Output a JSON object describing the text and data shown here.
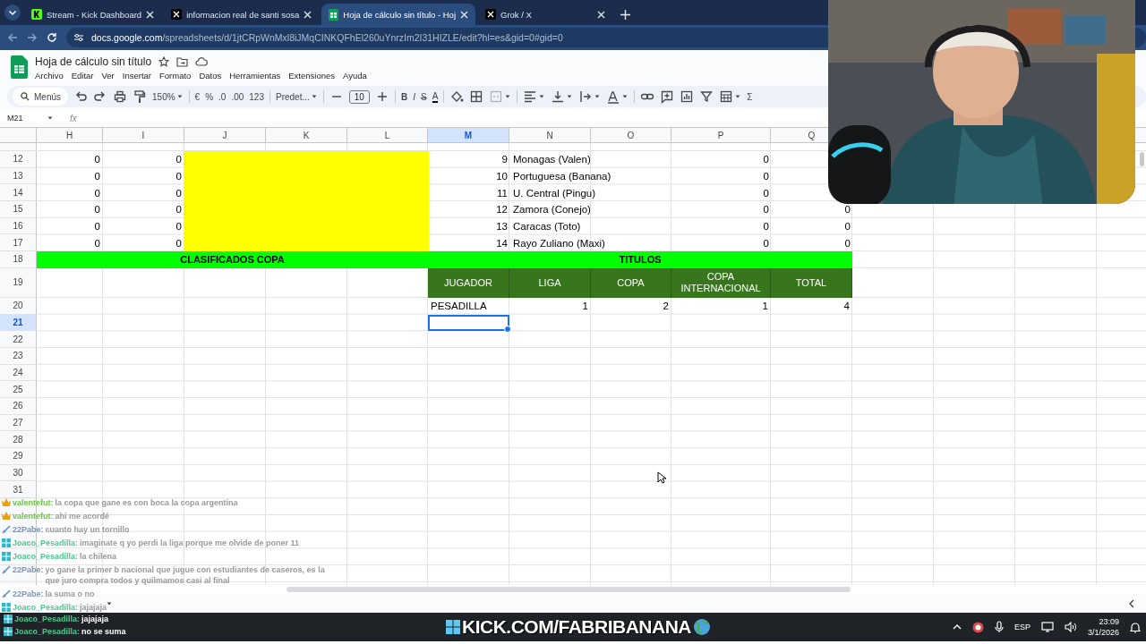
{
  "browser": {
    "tabs": [
      {
        "title": "Stream - Kick Dashboard",
        "kind": "dashboard",
        "selected": false
      },
      {
        "title": "informacion real de santi sosa",
        "kind": "social",
        "selected": false
      },
      {
        "title": "Hoja de cálculo sin título - Hoj",
        "kind": "spreadsheet",
        "selected": true
      },
      {
        "title": "Grok / X",
        "kind": "social",
        "selected": false
      }
    ],
    "url": "**docs.google.com**/spreadsheets/d/1jtCRpWnMxl8iJMqCINKQFhEl260uYnrzIm2I31HIZLE/edit?hl=es&gid=0#gid=0"
  },
  "sheet_app": {
    "title": "Hoja de cálculo sin título",
    "menu": [
      "Archivo",
      "Editar",
      "Ver",
      "Insertar",
      "Formato",
      "Datos",
      "Herramientas",
      "Extensiones",
      "Ayuda"
    ],
    "toolbar": {
      "search": "Menús",
      "zoom": "150%",
      "currency": "€",
      "percent": "%",
      "decrease_decimals": ".0",
      "increase_decimals": ".00",
      "number_format": "123",
      "font": "Predet...",
      "font_size": "10",
      "bold": "B",
      "italic": "I",
      "strikethrough": "S",
      "text_color": "A",
      "sum": "Σ"
    },
    "name_box": "M21",
    "formula_label": "fx"
  },
  "sheet": {
    "columns": [
      {
        "letter": "H",
        "selected": false
      },
      {
        "letter": "I",
        "selected": false
      },
      {
        "letter": "J",
        "selected": false
      },
      {
        "letter": "K",
        "selected": false
      },
      {
        "letter": "L",
        "selected": false
      },
      {
        "letter": "M",
        "selected": true
      },
      {
        "letter": "N",
        "selected": false
      },
      {
        "letter": "O",
        "selected": false
      },
      {
        "letter": "P",
        "selected": false
      },
      {
        "letter": "Q",
        "selected": false
      }
    ],
    "rows": [
      {
        "number": "12",
        "selected": false,
        "kind": "data",
        "highlighted": true,
        "cells": {
          "H": "0",
          "I": "0",
          "M": "9",
          "N": "Monagas (Valen)",
          "P": "0"
        }
      },
      {
        "number": "13",
        "selected": false,
        "kind": "data",
        "highlighted": true,
        "cells": {
          "H": "0",
          "I": "0",
          "M": "10",
          "N": "Portuguesa (Banana)",
          "P": "0"
        }
      },
      {
        "number": "14",
        "selected": false,
        "kind": "data",
        "highlighted": true,
        "cells": {
          "H": "0",
          "I": "0",
          "M": "11",
          "N": "U. Central (Pingu)",
          "P": "0"
        }
      },
      {
        "number": "15",
        "selected": false,
        "kind": "data",
        "highlighted": true,
        "cells": {
          "H": "0",
          "I": "0",
          "M": "12",
          "N": "Zamora (Conejo)",
          "P": "0",
          "Q": "0"
        }
      },
      {
        "number": "16",
        "selected": false,
        "kind": "data",
        "highlighted": true,
        "cells": {
          "H": "0",
          "I": "0",
          "M": "13",
          "N": "Caracas (Toto)",
          "P": "0",
          "Q": "0"
        }
      },
      {
        "number": "17",
        "selected": false,
        "kind": "data",
        "highlighted": true,
        "cells": {
          "H": "0",
          "I": "0",
          "M": "14",
          "N": "Rayo Zuliano (Maxi)",
          "P": "0",
          "Q": "0"
        }
      },
      {
        "number": "18",
        "selected": false,
        "kind": "banner",
        "left": {
          "text": "CLASIFICADOS COPA",
          "color": "#00ff00"
        },
        "right": {
          "text": "TITULOS",
          "color": "#00ff00"
        }
      },
      {
        "number": "19",
        "selected": false,
        "kind": "header",
        "color": "#38761d",
        "cells": {
          "M": "JUGADOR",
          "N": "LIGA",
          "O": "COPA",
          "P": "COPA INTERNACIONAL",
          "Q": "TOTAL"
        }
      },
      {
        "number": "20",
        "selected": false,
        "kind": "data",
        "cells": {
          "M": "PESADILLA",
          "N": "1",
          "O": "2",
          "P": "1",
          "Q": "4"
        }
      },
      {
        "number": "21",
        "selected": true,
        "kind": "data"
      },
      {
        "number": "22",
        "selected": false,
        "kind": "data"
      },
      {
        "number": "23",
        "selected": false,
        "kind": "data"
      },
      {
        "number": "24",
        "selected": false,
        "kind": "data"
      },
      {
        "number": "25",
        "selected": false,
        "kind": "data"
      },
      {
        "number": "26",
        "selected": false,
        "kind": "data"
      },
      {
        "number": "27",
        "selected": false,
        "kind": "data"
      },
      {
        "number": "28",
        "selected": false,
        "kind": "data"
      },
      {
        "number": "29",
        "selected": false,
        "kind": "data"
      },
      {
        "number": "30",
        "selected": false,
        "kind": "data"
      },
      {
        "number": "31",
        "selected": false,
        "kind": "data"
      }
    ]
  },
  "chat": [
    {
      "user": "valentefut:",
      "kind": "crown",
      "color": "#6cc644",
      "text": "la copa que gane es con boca la copa argentina"
    },
    {
      "user": "valentefut:",
      "kind": "crown",
      "color": "#6cc644",
      "text": "ahi me acordé"
    },
    {
      "user": "22Pabe:",
      "kind": "sword",
      "color": "#7f93b8",
      "text": "cuanto hay un tornillo"
    },
    {
      "user": "Joaco_Pesadilla:",
      "kind": "grid",
      "color": "#4fc98f",
      "text": "imaginate q yo perdi la liga porque me olvide de poner 11"
    },
    {
      "user": "Joaco_Pesadilla:",
      "kind": "grid",
      "color": "#4fc98f",
      "text": "la chilena"
    },
    {
      "user": "22Pabe:",
      "kind": "sword",
      "color": "#7f93b8",
      "text": "yo gane la primer b nacional que jugue con estudiantes de caseros, es la que juro compra todos y quilmamos casi al final"
    },
    {
      "user": "22Pabe:",
      "kind": "sword",
      "color": "#7f93b8",
      "text": "la suma o no"
    },
    {
      "user": "Joaco_Pesadilla:",
      "kind": "grid",
      "color": "#4fc98f",
      "text": "jajajaja"
    }
  ],
  "taskbar_chat": [
    {
      "user": "Joaco_Pesadilla:",
      "kind": "grid",
      "color": "#4fc98f",
      "text": "jajajaja"
    },
    {
      "user": "Joaco_Pesadilla:",
      "kind": "grid",
      "color": "#4fc98f",
      "text": "no se suma"
    }
  ],
  "stream_overlay": {
    "url": "KICK.COM/FABRIBANANA"
  },
  "tray": {
    "language": "ESP",
    "time": "23:09",
    "date": "3/1/2026"
  }
}
